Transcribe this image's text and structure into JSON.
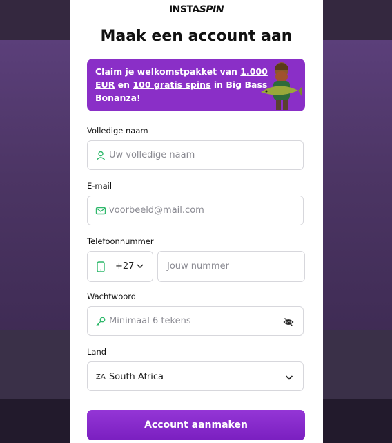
{
  "modal": {
    "logo": {
      "part1": "INSTA",
      "part2": "SPIN"
    },
    "title": "Maak een account aan",
    "promo": {
      "text_before": "Claim je welkomstpakket van ",
      "amount": "1.000 EUR",
      "text_mid": " en ",
      "spins": "100 gratis spins",
      "text_after": " in Big Bass Bonanza!"
    },
    "full_name": {
      "label": "Volledige naam",
      "placeholder": "Uw volledige naam",
      "icon": "user-icon"
    },
    "email": {
      "label": "E-mail",
      "placeholder": "voorbeeld@mail.com",
      "icon": "mail-icon"
    },
    "phone": {
      "label": "Telefoonnummer",
      "country_code": "+27",
      "placeholder": "Jouw nummer",
      "icon": "phone-icon"
    },
    "password": {
      "label": "Wachtwoord",
      "placeholder": "Minimaal 6 tekens",
      "icon": "key-icon",
      "toggle_icon": "eye-off-icon"
    },
    "country": {
      "label": "Land",
      "iso": "ZA",
      "value": "South Africa"
    },
    "submit_label": "Account aanmaken"
  },
  "colors": {
    "accent": "#8a2fc7",
    "icon_green": "#2fb86b"
  }
}
